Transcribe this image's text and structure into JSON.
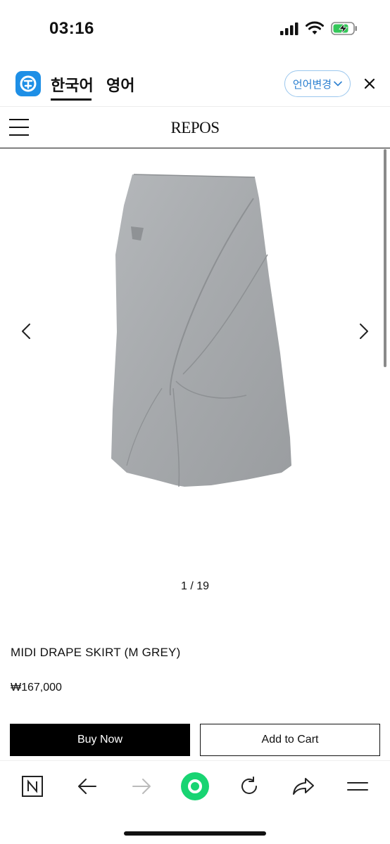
{
  "status_bar": {
    "time": "03:16"
  },
  "translate_bar": {
    "tab_korean": "한국어",
    "tab_english": "영어",
    "change_language": "언어변경"
  },
  "site": {
    "brand": "REPOS"
  },
  "gallery": {
    "counter": "1 / 19"
  },
  "product": {
    "name": "MIDI DRAPE SKIRT (M GREY)",
    "price": "₩167,000",
    "buy_now": "Buy Now",
    "add_to_cart": "Add to Cart"
  },
  "colors": {
    "accent_green": "#18d472",
    "brand_blue": "#1e8fe6",
    "skirt_grey": "#a9adb0"
  },
  "icons": {
    "toolbar": [
      "n-square-icon",
      "back-arrow-icon",
      "forward-arrow-icon",
      "green-circle-icon",
      "reload-icon",
      "share-icon",
      "menu-icon"
    ]
  }
}
